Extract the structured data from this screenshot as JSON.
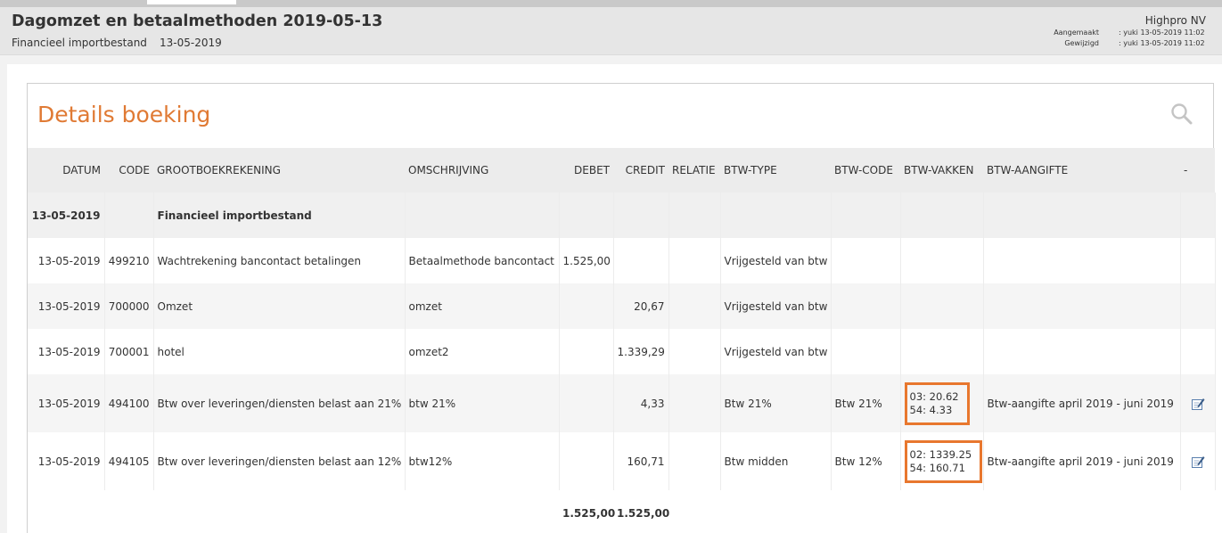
{
  "header": {
    "title": "Dagomzet en betaalmethoden 2019-05-13",
    "subtitle": "Financieel importbestand",
    "subtitle_date": "13-05-2019",
    "company": "Highpro NV",
    "created_label": "Aangemaakt",
    "created_value": ": yuki 13-05-2019 11:02",
    "modified_label": "Gewijzigd",
    "modified_value": ": yuki 13-05-2019 11:02"
  },
  "card": {
    "title": "Details boeking"
  },
  "table": {
    "columns": {
      "datum": "DATUM",
      "code": "CODE",
      "grootboek": "GROOTBOEKREKENING",
      "omschrijving": "OMSCHRIJVING",
      "debet": "DEBET",
      "credit": "CREDIT",
      "relatie": "RELATIE",
      "btw_type": "BTW-TYPE",
      "btw_code": "BTW-CODE",
      "btw_vakken": "BTW-VAKKEN",
      "btw_aangifte": "BTW-AANGIFTE",
      "actions": "-"
    },
    "group": {
      "date": "13-05-2019",
      "label": "Financieel importbestand"
    },
    "rows": [
      {
        "datum": "13-05-2019",
        "code": "499210",
        "grootboek": "Wachtrekening bancontact betalingen",
        "omschrijving": "Betaalmethode bancontact",
        "debet": "1.525,00",
        "credit": "",
        "relatie": "",
        "btw_type": "Vrijgesteld van btw",
        "btw_code": "",
        "vak1": "",
        "vak2": "",
        "btw_aangifte": ""
      },
      {
        "datum": "13-05-2019",
        "code": "700000",
        "grootboek": "Omzet",
        "omschrijving": "omzet",
        "debet": "",
        "credit": "20,67",
        "relatie": "",
        "btw_type": "Vrijgesteld van btw",
        "btw_code": "",
        "vak1": "",
        "vak2": "",
        "btw_aangifte": ""
      },
      {
        "datum": "13-05-2019",
        "code": "700001",
        "grootboek": "hotel",
        "omschrijving": "omzet2",
        "debet": "",
        "credit": "1.339,29",
        "relatie": "",
        "btw_type": "Vrijgesteld van btw",
        "btw_code": "",
        "vak1": "",
        "vak2": "",
        "btw_aangifte": ""
      },
      {
        "datum": "13-05-2019",
        "code": "494100",
        "grootboek": "Btw over leveringen/diensten belast aan 21%",
        "omschrijving": "btw 21%",
        "debet": "",
        "credit": "4,33",
        "relatie": "",
        "btw_type": "Btw 21%",
        "btw_code": "Btw 21%",
        "vak1": "03: 20.62",
        "vak2": "54: 4.33",
        "btw_aangifte": "Btw-aangifte april 2019 - juni 2019"
      },
      {
        "datum": "13-05-2019",
        "code": "494105",
        "grootboek": "Btw over leveringen/diensten belast aan 12%",
        "omschrijving": "btw12%",
        "debet": "",
        "credit": "160,71",
        "relatie": "",
        "btw_type": "Btw midden",
        "btw_code": "Btw 12%",
        "vak1": "02: 1339.25",
        "vak2": "54: 160.71",
        "btw_aangifte": "Btw-aangifte april 2019 - juni 2019"
      }
    ],
    "totals": {
      "debet": "1.525,00",
      "credit": "1.525,00"
    }
  },
  "colors": {
    "accent": "#e07a34",
    "highlight_border": "#e8772e"
  }
}
